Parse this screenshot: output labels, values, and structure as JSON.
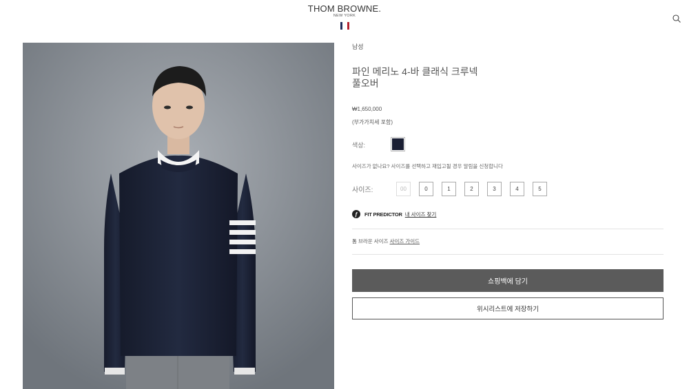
{
  "header": {
    "brand": "THOM BROWNE.",
    "brand_sub": "NEW YORK",
    "flag_colors": [
      "#1f2b5b",
      "#ffffff",
      "#b3202e"
    ]
  },
  "product": {
    "gender": "남성",
    "title_line1": "파인 메리노 4-바 클래식 크루넥",
    "title_line2": "풀오버",
    "price": "₩1,650,000",
    "vat_note": "(부가가치세 포함)",
    "color_label": "색상:",
    "color_swatch": "#1a1f33",
    "size_note": "사이즈가 없나요? 사이즈를 선택하고 재입고될 경우 알림을 신청합니다",
    "size_label": "사이즈:",
    "sizes": [
      "00",
      "0",
      "1",
      "2",
      "3",
      "4",
      "5"
    ],
    "fit_predictor": "FIT PREDICTOR",
    "fit_link": "내 사이즈 찾기",
    "guide_text": "톰 브라운 사이즈",
    "guide_link": "사이즈 가이드",
    "add_to_bag": "쇼핑백에 담기",
    "wishlist": "위시리스트에 저장하기"
  },
  "colors": {
    "bag_button": "#5b5b5b",
    "sweater": "#1c2236",
    "background": "#8f959c"
  },
  "icons": {
    "search": "search-icon",
    "fit": "fit-predictor-icon"
  }
}
